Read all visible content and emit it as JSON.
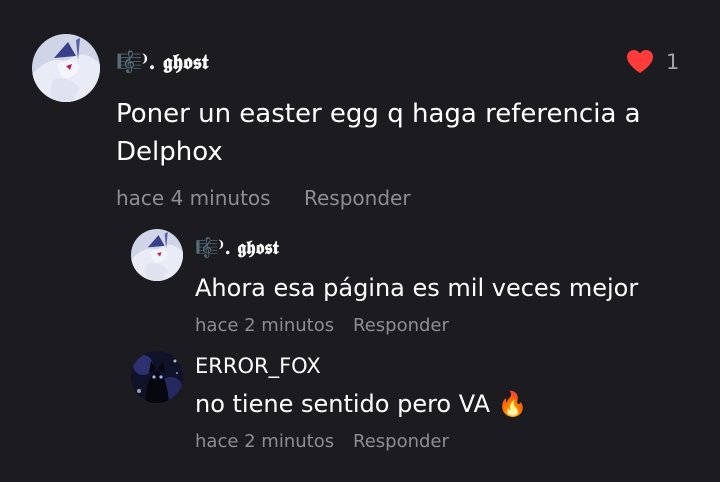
{
  "comment": {
    "author": "🎼⁾. 𝖌𝖍𝖔𝖘𝖙",
    "text_line1": "Poner un easter egg q haga referencia a",
    "text_line2": "Delphox",
    "time": "hace 4 minutos",
    "reply_label": "Responder",
    "likes": "1"
  },
  "replies": [
    {
      "author": "🎼⁾. 𝖌𝖍𝖔𝖘𝖙",
      "text": "Ahora esa página es mil veces mejor",
      "time": "hace 2 minutos",
      "reply_label": "Responder"
    },
    {
      "author": "ERROR_FOX",
      "text": "no tiene sentido pero VA 🔥",
      "time": "hace 2 minutos",
      "reply_label": "Responder"
    }
  ],
  "colors": {
    "background": "#1c1b20",
    "heart": "#ff3b3b",
    "meta": "#8e8d95"
  },
  "icons": {
    "like": "heart-icon"
  }
}
